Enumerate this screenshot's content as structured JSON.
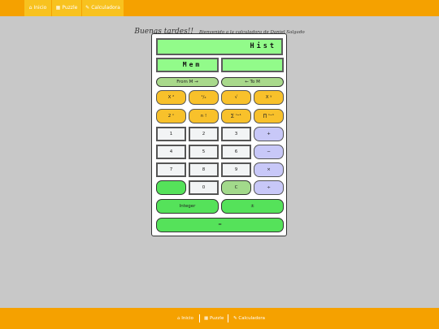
{
  "nav": {
    "items": [
      {
        "label": "Inicio",
        "icon": "⌂"
      },
      {
        "label": "Puzzle",
        "icon": "▦"
      },
      {
        "label": "Calculadora",
        "icon": "✎"
      }
    ]
  },
  "greeting": {
    "main": "Buenas tardes!!",
    "sub": "Bienvenido a la calculadora de Daniel Salgado"
  },
  "calculator": {
    "history_display": "Hist",
    "memory_display": "Mem",
    "result_display": "",
    "from_memory": "From M →",
    "to_memory": "← To M",
    "square": "X ²",
    "reciprocal": "¹/ₓ",
    "sqrt": "√",
    "power": "X ʸ",
    "power_of_two": "2 ⁿ",
    "factorial": "n !",
    "summation": "∑ ⁿ⁼¹",
    "product": "∏ ⁿ⁼¹",
    "digits": [
      "1",
      "2",
      "3",
      "4",
      "5",
      "6",
      "7",
      "8",
      "9",
      "0"
    ],
    "plus": "+",
    "minus": "−",
    "multiply": "×",
    "divide": "÷",
    "dot": "",
    "clear": "C",
    "integer": "Integer",
    "sign": "±",
    "equals": "="
  },
  "footer": {
    "items": [
      {
        "label": "Inicio",
        "icon": "⌂"
      },
      {
        "label": "Puzzle",
        "icon": "▦"
      },
      {
        "label": "Calculadora",
        "icon": "✎"
      }
    ]
  },
  "colors": {
    "brand_orange": "#f5a100",
    "active_nav": "#f8c21f",
    "display_green": "#92fb8a",
    "op_yellow": "#f8c12b",
    "op_purple": "#c8c8f8",
    "action_green": "#55e25a"
  }
}
